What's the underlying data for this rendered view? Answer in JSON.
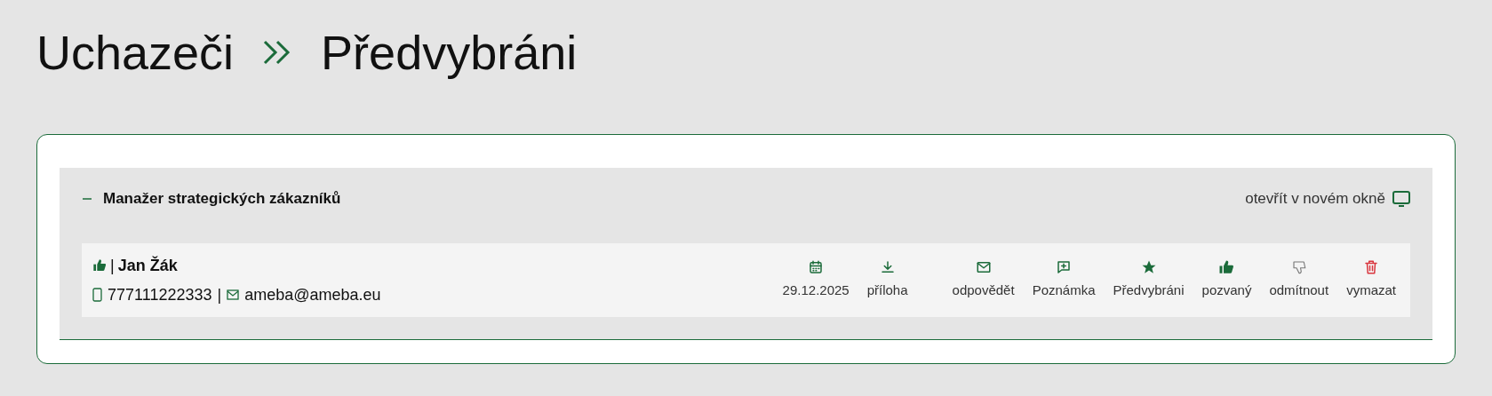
{
  "breadcrumb": [
    "Uchazeči",
    "Předvybráni"
  ],
  "section": {
    "title": "Manažer strategických zákazníků",
    "expanded": true,
    "open_link": "otevřít v novém okně"
  },
  "candidates": [
    {
      "name": "Jan Žák",
      "liked": true,
      "name_separator": "|",
      "phone": "777111222333",
      "contact_separator": "|",
      "email": "ameba@ameba.eu",
      "actions": [
        {
          "kind": "date",
          "label": "29.12.2025"
        },
        {
          "kind": "download",
          "label": "příloha"
        },
        {
          "kind": "mail",
          "label": "odpovědět"
        },
        {
          "kind": "note",
          "label": "Poznámka"
        },
        {
          "kind": "star",
          "label": "Předvybráni"
        },
        {
          "kind": "thumb-up",
          "label": "pozvaný"
        },
        {
          "kind": "thumb-down",
          "label": "odmítnout"
        },
        {
          "kind": "trash",
          "label": "vymazat"
        }
      ]
    }
  ]
}
